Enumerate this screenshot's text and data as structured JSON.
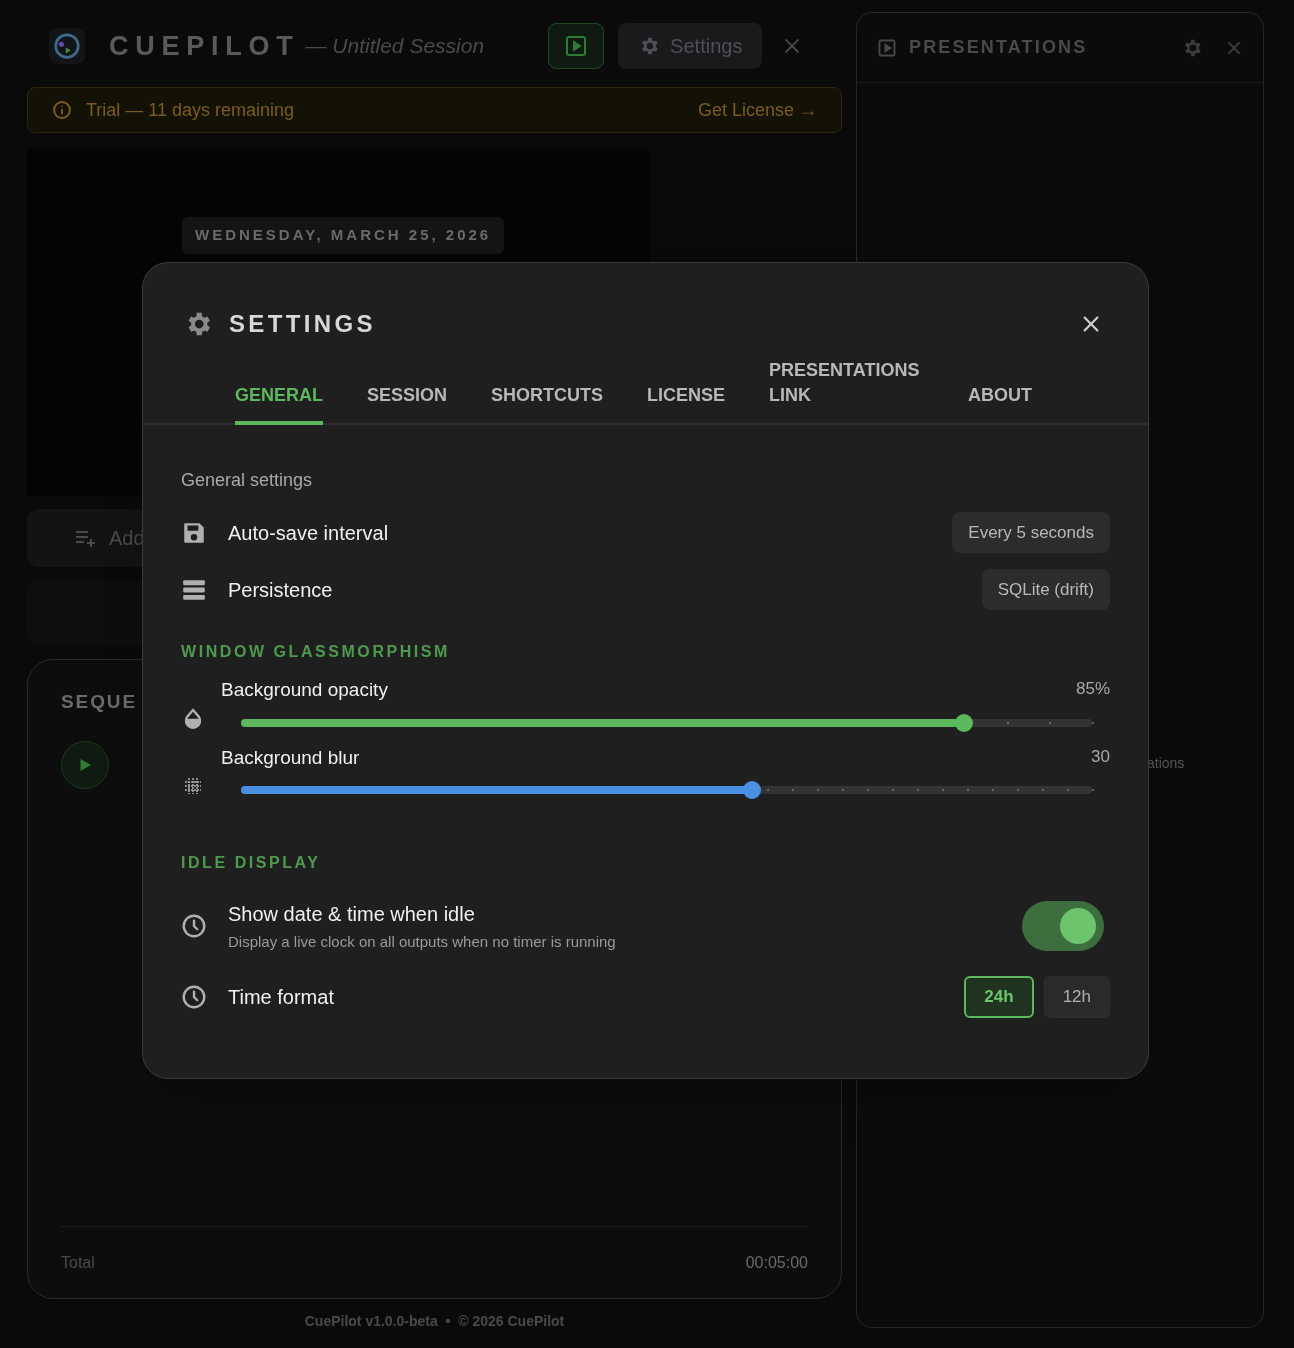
{
  "app": {
    "name": "CUEPILOT",
    "session": "— Untitled Session",
    "settings_button": "Settings"
  },
  "trial_banner": {
    "text": "Trial — 11 days remaining",
    "action": "Get License →"
  },
  "preview": {
    "date": "WEDNESDAY, MARCH 25, 2026"
  },
  "add_button": "Add",
  "sequence": {
    "title": "SEQUE",
    "total_label": "Total",
    "total_value": "00:05:00"
  },
  "footer": "CuePilot v1.0.0-beta  •  © 2026 CuePilot",
  "presentations_panel": {
    "title": "PRESENTATIONS",
    "hint": "ations"
  },
  "settings": {
    "title": "SETTINGS",
    "tabs": [
      {
        "label": "GENERAL",
        "selected": true
      },
      {
        "label": "SESSION",
        "selected": false
      },
      {
        "label": "SHORTCUTS",
        "selected": false
      },
      {
        "label": "LICENSE",
        "selected": false
      },
      {
        "label": "PRESENTATIONS LINK",
        "selected": false
      },
      {
        "label": "ABOUT",
        "selected": false
      }
    ],
    "section_heading": "General settings",
    "info_rows": [
      {
        "label": "Auto-save interval",
        "value": "Every 5 seconds"
      },
      {
        "label": "Persistence",
        "value": "SQLite (drift)"
      }
    ],
    "glass_heading": "WINDOW GLASSMORPHISM",
    "sliders": [
      {
        "label": "Background opacity",
        "reading": "85%",
        "level": 0.85,
        "color": "#5cb85c"
      },
      {
        "label": "Background blur",
        "reading": "30",
        "level": 0.6,
        "color": "#4a90e2"
      }
    ],
    "idle_heading": "IDLE DISPLAY",
    "idle_toggle": {
      "label": "Show date & time when idle",
      "description": "Display a live clock on all outputs when no timer is running",
      "on": true
    },
    "time_format": {
      "label": "Time format",
      "options": [
        {
          "label": "24h",
          "selected": true
        },
        {
          "label": "12h",
          "selected": false
        }
      ]
    }
  }
}
